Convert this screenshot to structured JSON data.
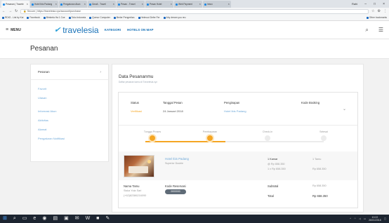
{
  "browser": {
    "tabs": [
      {
        "label": "Pesanan | Travele"
      },
      {
        "label": "Hotel Ibis Padang"
      },
      {
        "label": "Pengaturan Akun"
      },
      {
        "label": "Gmail - Travel"
      },
      {
        "label": "Pesan - Travel"
      },
      {
        "label": "Pesan Hotel"
      },
      {
        "label": "Web Payment"
      },
      {
        "label": "Inbox"
      }
    ],
    "user_label": "Rahi",
    "url": "https://travelesia.xyz/account/purchase",
    "url_secure_label": "Secure",
    "bookmarks": [
      {
        "label": "RDIG - List by Kai"
      },
      {
        "label": "Facebook"
      },
      {
        "label": "Bimbela Ha 1 Coe"
      },
      {
        "label": "Toko Indoneia"
      },
      {
        "label": "Qurnur Computer"
      },
      {
        "label": "Berler Pengertian"
      },
      {
        "label": "Helmuut Defer Fer"
      },
      {
        "label": "Ahy dream you reu"
      }
    ],
    "other_bookmarks": "Other bookmarks"
  },
  "site": {
    "menu_label": "MENU",
    "logo_text": "travelesia",
    "nav_links": [
      "KATEGORI",
      "HOTELS ON MAP"
    ]
  },
  "page": {
    "title": "Pesanan"
  },
  "sidebar": {
    "items": [
      {
        "label": "Pesanan"
      },
      {
        "label": "Favorit"
      },
      {
        "label": "Ulasan"
      },
      {
        "label": "Informasi Akun"
      },
      {
        "label": "Aktivitas"
      },
      {
        "label": "Alamat"
      },
      {
        "label": "Pengaturan Notifikasi"
      }
    ]
  },
  "main": {
    "title": "Data Pesananmu",
    "subtitle": "Daftar pesanan kamu di Travelesia.xyz",
    "columns": {
      "status_h": "Status",
      "status_v": "Verifikasi",
      "date_h": "Tanggal Pesan",
      "date_v": "24 Januari 2018",
      "lodging_h": "Penginapan",
      "lodging_v": "Hotel Ibis Padang",
      "code_h": "Kode Booking",
      "code_v": ""
    },
    "steps": [
      {
        "label": "Tunggu Proses",
        "done": true
      },
      {
        "label": "Pembayaran",
        "done": true
      },
      {
        "label": "Check-in",
        "done": false
      },
      {
        "label": "Selesai",
        "done": false
      }
    ],
    "progress": 0.45,
    "hotel": {
      "name": "Hotel Ibis Padang",
      "room": "Superior Double",
      "qty": "1 Kamar",
      "unit_price": "@ Rp 658.350",
      "calc": "1 x Rp 658.350",
      "nights": "1 Tamu",
      "total_line": "Rp 658.350"
    },
    "guest": {
      "name_label": "Nama Tamu",
      "name_value": "Siska Yola Sari",
      "phone": "(+62)82386216090",
      "res_label": "Kode Reservasi",
      "res_value": "0000000",
      "subtotal_label": "Subtotal",
      "subtotal_value": "Rp 658.350",
      "total_label": "Total",
      "total_value": "Rp 658.350"
    }
  },
  "taskbar": {
    "time": "10:22",
    "date": "26/01/2018"
  }
}
